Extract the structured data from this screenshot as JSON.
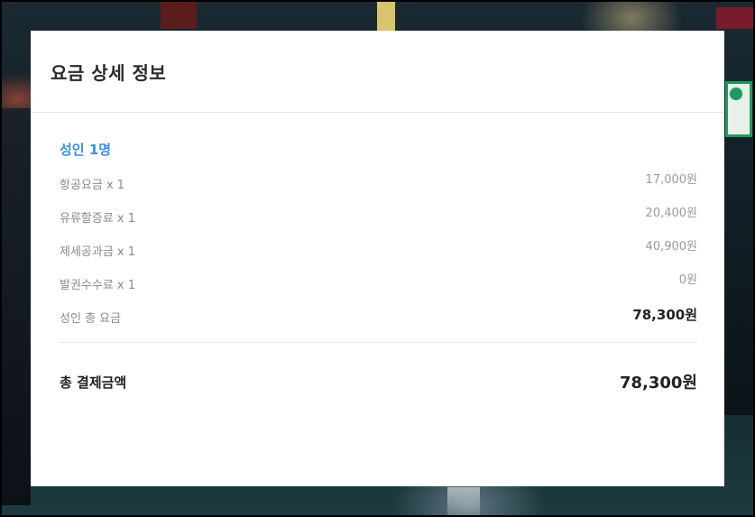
{
  "modal": {
    "title": "요금 상세 정보"
  },
  "adult": {
    "section_title": "성인 1명",
    "items": [
      {
        "label": "항공요금 x 1",
        "value": "17,000원"
      },
      {
        "label": "유류할증료 x 1",
        "value": "20,400원"
      },
      {
        "label": "제세공과금 x 1",
        "value": "40,900원"
      },
      {
        "label": "발권수수료 x 1",
        "value": "0원"
      }
    ],
    "subtotal_label": "성인 총 요금",
    "subtotal_value": "78,300원"
  },
  "total": {
    "label": "총 결제금액",
    "value": "78,300원"
  },
  "colors": {
    "accent": "#3a8ee6",
    "text": "#222222",
    "muted": "#8a8a8a"
  }
}
